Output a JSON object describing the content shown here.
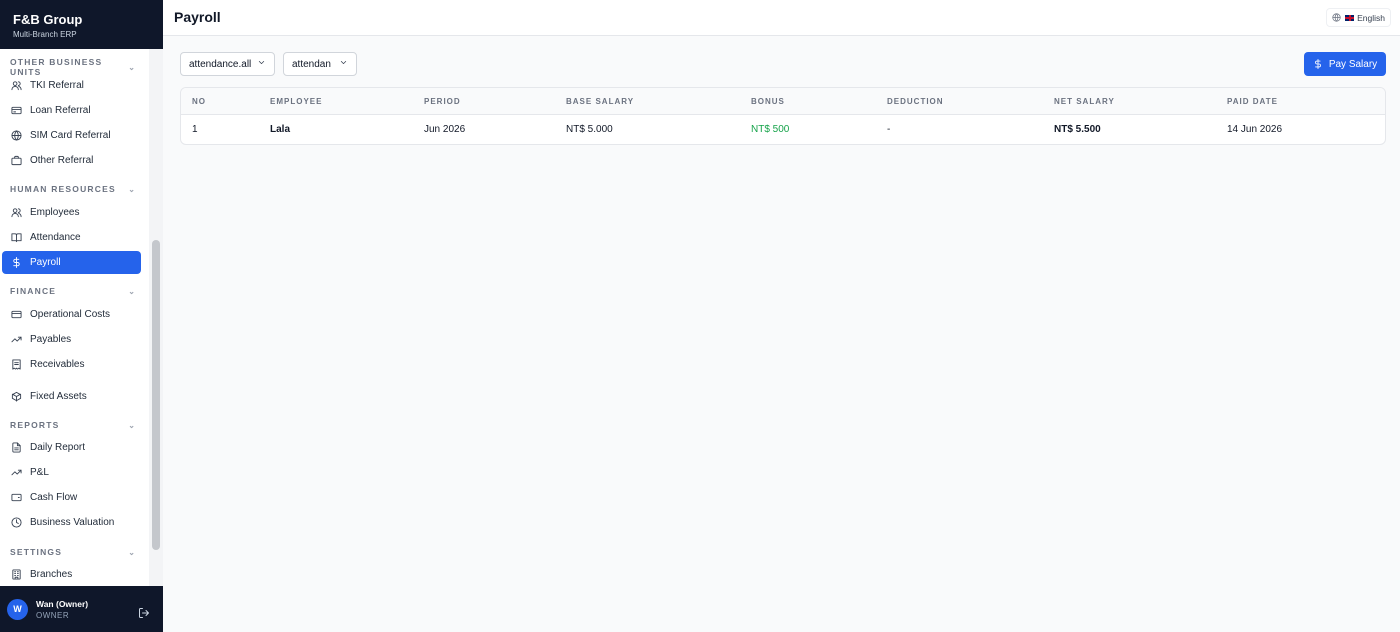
{
  "brand": {
    "title": "F&B Group",
    "subtitle": "Multi-Branch ERP"
  },
  "sidebar": {
    "sections": [
      {
        "label": "OTHER BUSINESS UNITS",
        "items": [
          "TKI Referral",
          "Loan Referral",
          "SIM Card Referral",
          "Other Referral"
        ]
      },
      {
        "label": "HUMAN RESOURCES",
        "items": [
          "Employees",
          "Attendance",
          "Payroll"
        ]
      },
      {
        "label": "FINANCE",
        "items": [
          "Operational Costs",
          "Payables",
          "Receivables",
          "Fixed Assets"
        ]
      },
      {
        "label": "REPORTS",
        "items": [
          "Daily Report",
          "P&L",
          "Cash Flow",
          "Business Valuation"
        ]
      },
      {
        "label": "SETTINGS",
        "items": [
          "Branches"
        ]
      }
    ],
    "active_item": "Payroll"
  },
  "user": {
    "initial": "W",
    "name": "Wan (Owner)",
    "role": "OWNER"
  },
  "header": {
    "title": "Payroll",
    "language": "English"
  },
  "filters": {
    "select1": "attendance.all",
    "select2": "attendan"
  },
  "actions": {
    "pay_salary": "Pay Salary"
  },
  "table": {
    "columns": [
      "NO",
      "EMPLOYEE",
      "PERIOD",
      "BASE SALARY",
      "BONUS",
      "DEDUCTION",
      "NET SALARY",
      "PAID DATE"
    ],
    "rows": [
      [
        "1",
        "Lala",
        "Jun 2026",
        "NT$ 5.000",
        "NT$ 500",
        "-",
        "NT$ 5.500",
        "14 Jun 2026"
      ]
    ]
  },
  "colors": {
    "accent": "#2563eb",
    "sidebar_dark": "#0f172a",
    "bonus_green": "#16a34a"
  }
}
